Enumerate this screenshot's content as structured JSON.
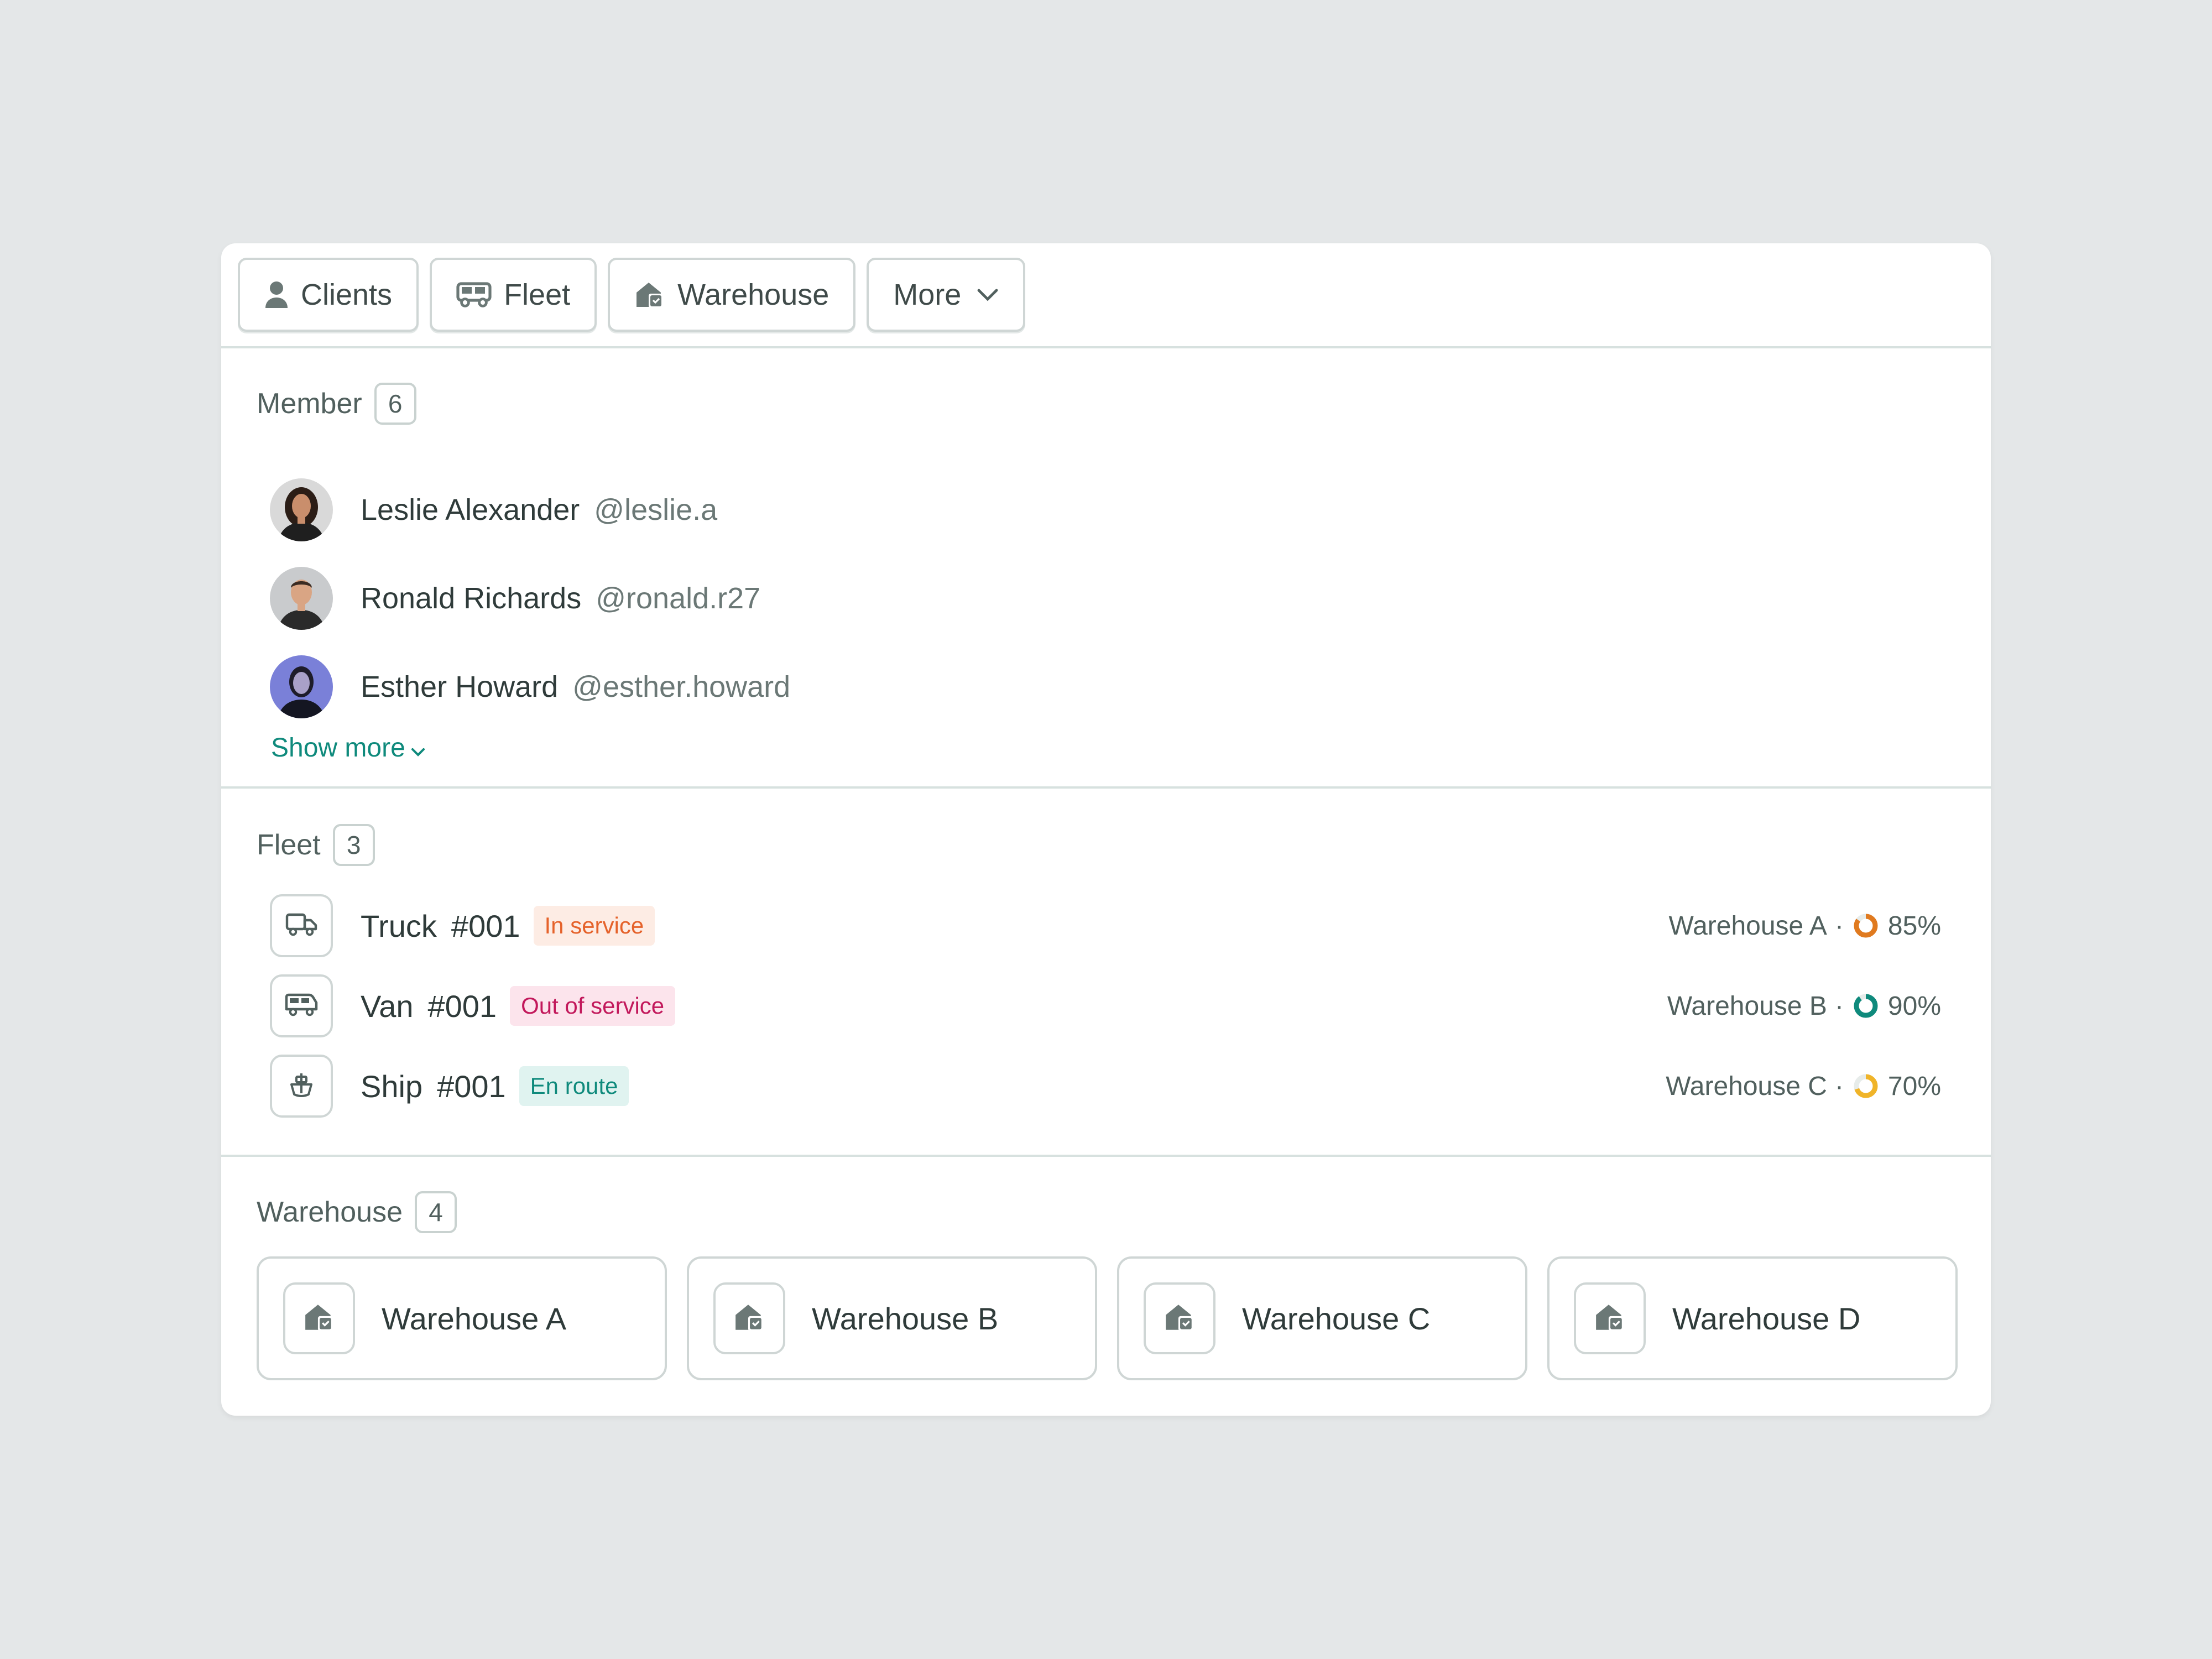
{
  "tabs": [
    {
      "label": "Clients",
      "icon": "user-icon"
    },
    {
      "label": "Fleet",
      "icon": "bus-icon"
    },
    {
      "label": "Warehouse",
      "icon": "warehouse-icon"
    },
    {
      "label": "More",
      "icon": "chevron-down-icon"
    }
  ],
  "members": {
    "title": "Member",
    "count": "6",
    "items": [
      {
        "name": "Leslie Alexander",
        "handle": "@leslie.a"
      },
      {
        "name": "Ronald Richards",
        "handle": "@ronald.r27"
      },
      {
        "name": "Esther Howard",
        "handle": "@esther.howard"
      }
    ],
    "show_more": "Show more"
  },
  "fleet": {
    "title": "Fleet",
    "count": "3",
    "items": [
      {
        "name": "Truck",
        "number": "#001",
        "status": "In service",
        "status_color": "#e5622a",
        "status_bg": "#fdece4",
        "icon": "truck-icon",
        "warehouse": "Warehouse A",
        "percent": "85%",
        "percent_value": 0.85,
        "ring_color": "#e07a1f"
      },
      {
        "name": "Van",
        "number": "#001",
        "status": "Out of service",
        "status_color": "#c2185b",
        "status_bg": "#fce4ec",
        "icon": "van-icon",
        "warehouse": "Warehouse B",
        "percent": "90%",
        "percent_value": 0.9,
        "ring_color": "#0f8a7c"
      },
      {
        "name": "Ship",
        "number": "#001",
        "status": "En route",
        "status_color": "#0f8a7c",
        "status_bg": "#e0f3f0",
        "icon": "ship-icon",
        "warehouse": "Warehouse C",
        "percent": "70%",
        "percent_value": 0.7,
        "ring_color": "#f0b429"
      }
    ]
  },
  "warehouse": {
    "title": "Warehouse",
    "count": "4",
    "items": [
      "Warehouse A",
      "Warehouse B",
      "Warehouse C",
      "Warehouse D"
    ]
  },
  "colors": {
    "accent": "#0f8a7c",
    "background": "#e4e7e8",
    "border": "#cfd6d5"
  }
}
